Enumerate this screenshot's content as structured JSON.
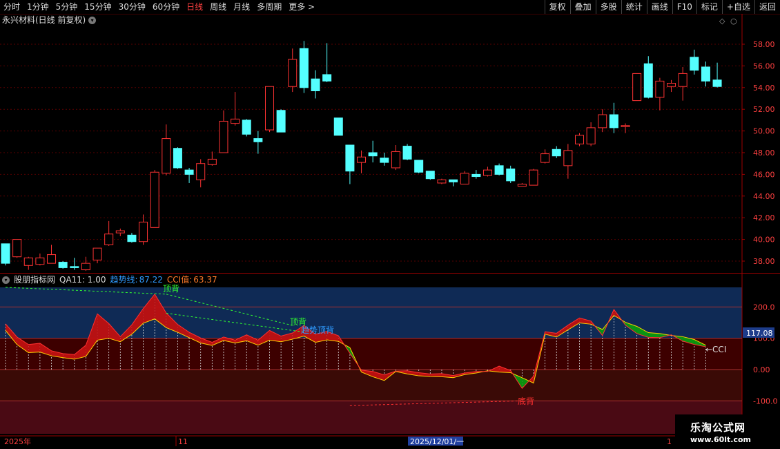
{
  "toolbar": {
    "periods": [
      "分时",
      "1分钟",
      "5分钟",
      "15分钟",
      "30分钟",
      "60分钟",
      "日线",
      "周线",
      "月线",
      "多周期",
      "更多 >"
    ],
    "active_period": "日线",
    "right_buttons": [
      "复权",
      "叠加",
      "多股",
      "统计",
      "画线",
      "F10",
      "标记",
      "+自选",
      "返回"
    ]
  },
  "main": {
    "title": "永兴材料(日线 前复权)",
    "price_axis": [
      "58.00",
      "56.00",
      "54.00",
      "52.00",
      "50.00",
      "48.00",
      "46.00",
      "44.00",
      "42.00",
      "40.00",
      "38.00"
    ],
    "candles": [
      [
        39.6,
        37.8,
        39.6,
        37.6
      ],
      [
        38.4,
        40.0,
        40.0,
        38.3
      ],
      [
        37.6,
        38.3,
        38.4,
        37.2
      ],
      [
        37.7,
        38.3,
        38.7,
        37.6
      ],
      [
        37.8,
        38.6,
        39.5,
        37.8
      ],
      [
        37.9,
        37.4,
        38.0,
        37.3
      ],
      [
        37.5,
        37.4,
        38.3,
        37.2
      ],
      [
        37.2,
        37.8,
        38.4,
        37.1
      ],
      [
        38.1,
        39.2,
        39.2,
        37.8
      ],
      [
        39.5,
        40.5,
        41.7,
        39.4
      ],
      [
        40.6,
        40.8,
        41.0,
        40.3
      ],
      [
        40.4,
        39.8,
        40.6,
        39.7
      ],
      [
        39.8,
        41.6,
        42.3,
        39.5
      ],
      [
        41.1,
        46.2,
        46.4,
        41.1
      ],
      [
        46.1,
        49.3,
        50.6,
        45.9
      ],
      [
        48.4,
        46.6,
        48.5,
        46.5
      ],
      [
        46.4,
        46.0,
        46.6,
        45.2
      ],
      [
        45.5,
        47.0,
        47.4,
        44.8
      ],
      [
        46.9,
        47.4,
        48.1,
        46.8
      ],
      [
        48.0,
        50.9,
        51.9,
        48.0
      ],
      [
        50.7,
        51.1,
        53.6,
        50.5
      ],
      [
        51.0,
        49.7,
        51.1,
        49.5
      ],
      [
        49.3,
        49.0,
        50.0,
        47.9
      ],
      [
        50.1,
        54.1,
        54.1,
        49.9
      ],
      [
        51.9,
        49.9,
        52.0,
        49.9
      ],
      [
        54.1,
        56.6,
        57.6,
        53.6
      ],
      [
        57.6,
        54.0,
        58.3,
        53.5
      ],
      [
        54.8,
        53.7,
        55.6,
        53.0
      ],
      [
        55.2,
        54.6,
        58.1,
        54.5
      ],
      [
        51.2,
        49.6,
        51.2,
        49.6
      ],
      [
        48.7,
        46.3,
        48.7,
        45.1
      ],
      [
        47.1,
        47.6,
        48.2,
        46.1
      ],
      [
        48.0,
        47.7,
        49.1,
        47.1
      ],
      [
        47.5,
        47.1,
        48.0,
        46.8
      ],
      [
        46.6,
        48.1,
        48.7,
        46.4
      ],
      [
        48.6,
        47.4,
        48.8,
        47.3
      ],
      [
        47.3,
        46.2,
        47.3,
        46.1
      ],
      [
        46.3,
        45.6,
        46.3,
        45.5
      ],
      [
        45.2,
        45.5,
        45.6,
        45.1
      ],
      [
        45.5,
        45.3,
        45.5,
        44.9
      ],
      [
        45.1,
        46.1,
        46.3,
        45.1
      ],
      [
        46.0,
        45.8,
        46.4,
        45.6
      ],
      [
        45.9,
        46.4,
        46.7,
        45.8
      ],
      [
        46.8,
        46.0,
        47.0,
        45.9
      ],
      [
        46.5,
        45.4,
        46.8,
        45.2
      ],
      [
        44.9,
        45.1,
        45.2,
        44.9
      ],
      [
        45.0,
        46.4,
        46.5,
        45.0
      ],
      [
        47.1,
        47.9,
        48.3,
        47.0
      ],
      [
        48.3,
        47.7,
        48.6,
        47.5
      ],
      [
        46.8,
        48.2,
        48.8,
        45.6
      ],
      [
        48.8,
        49.6,
        49.8,
        48.6
      ],
      [
        48.8,
        50.3,
        50.8,
        48.6
      ],
      [
        50.3,
        51.5,
        52.0,
        49.9
      ],
      [
        51.5,
        50.3,
        52.6,
        49.8
      ],
      [
        50.4,
        50.5,
        50.7,
        49.8
      ],
      [
        52.8,
        55.3,
        55.3,
        52.8
      ],
      [
        56.2,
        53.1,
        56.9,
        53.0
      ],
      [
        53.1,
        54.6,
        54.9,
        51.9
      ],
      [
        54.1,
        54.4,
        54.7,
        53.6
      ],
      [
        54.1,
        55.3,
        55.9,
        52.8
      ],
      [
        56.8,
        55.6,
        57.5,
        55.2
      ],
      [
        55.9,
        54.6,
        56.4,
        54.1
      ],
      [
        54.7,
        54.1,
        56.3,
        54.0
      ]
    ]
  },
  "indicator": {
    "name": "股朋指标网",
    "param": "QA11: 1.00",
    "trend_label": "趋势线:",
    "trend_value": "87.22",
    "cci_label": "CCI值:",
    "cci_value": "63.37",
    "axis": [
      "200.0",
      "100.0",
      "0.00",
      "-100.0"
    ],
    "current_value": "117.08",
    "cci_arrow": "←CCI",
    "signals": {
      "top_div": "顶背",
      "trend_top_div": "趋势顶背",
      "bottom_div": "底背",
      "top_div_partial": "顶背"
    },
    "cci_series": [
      146,
      104,
      80,
      84,
      60,
      51,
      48,
      78,
      178,
      147,
      105,
      143,
      195,
      241,
      181,
      144,
      119,
      101,
      87,
      104,
      94,
      111,
      94,
      125,
      107,
      117,
      141,
      113,
      122,
      108,
      52,
      -2,
      -6,
      -17,
      -5,
      -4,
      -10,
      -14,
      -13,
      -19,
      -11,
      -6,
      -6,
      11,
      -3,
      -60,
      -21,
      121,
      116,
      142,
      165,
      155,
      109,
      192,
      142,
      115,
      103,
      102,
      111,
      91,
      80,
      73
    ],
    "trend_series": [
      125,
      80,
      54,
      56,
      44,
      38,
      33,
      42,
      94,
      100,
      89,
      113,
      148,
      162,
      134,
      119,
      102,
      85,
      77,
      93,
      85,
      92,
      78,
      94,
      89,
      97,
      107,
      87,
      95,
      90,
      70,
      -8,
      -23,
      -35,
      -6,
      -14,
      -20,
      -22,
      -23,
      -26,
      -16,
      -11,
      -4,
      -8,
      -10,
      -26,
      -43,
      113,
      104,
      127,
      149,
      145,
      128,
      173,
      151,
      138,
      118,
      115,
      109,
      105,
      96,
      78
    ]
  },
  "time_axis": {
    "left_label": "2025年",
    "mid_label": "11",
    "cursor_label": "2025/12/01/一",
    "right_label": "1"
  },
  "watermark": {
    "line1": "乐淘公式网",
    "line2": "www.60lt.com"
  },
  "colors": {
    "up": "#ff3333",
    "down": "#54ffff",
    "trend_line": "#2f7bff",
    "grid": "#7a0000"
  }
}
